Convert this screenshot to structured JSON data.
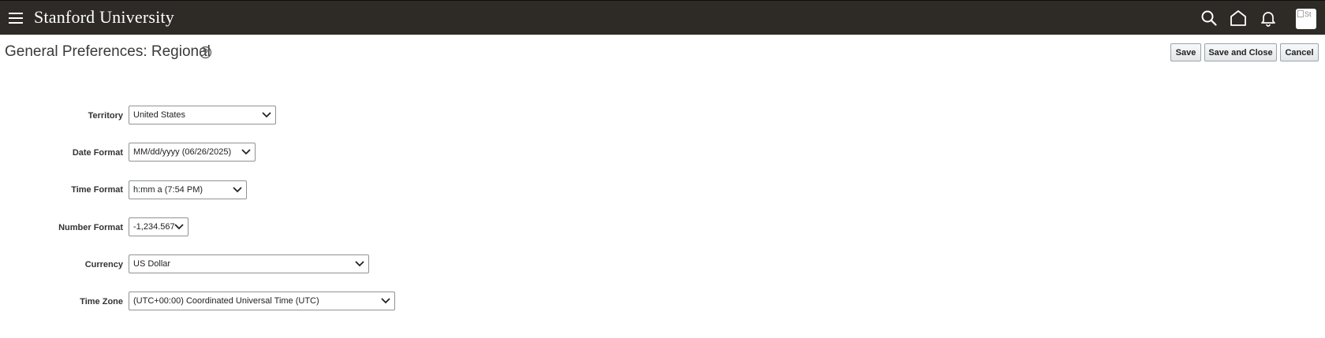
{
  "header": {
    "brand": "Stanford University",
    "avatar_alt": "St"
  },
  "page": {
    "title": "General Preferences: Regional"
  },
  "actions": {
    "save": "Save",
    "save_close": "Save and Close",
    "cancel": "Cancel"
  },
  "fields": {
    "territory": {
      "label": "Territory",
      "value": "United States"
    },
    "date_format": {
      "label": "Date Format",
      "value": "MM/dd/yyyy (06/26/2025)"
    },
    "time_format": {
      "label": "Time Format",
      "value": "h:mm a (7:54 PM)"
    },
    "number_format": {
      "label": "Number Format",
      "value": "-1,234.567"
    },
    "currency": {
      "label": "Currency",
      "value": "US Dollar"
    },
    "time_zone": {
      "label": "Time Zone",
      "value": "(UTC+00:00) Coordinated Universal Time (UTC)"
    }
  },
  "colors": {
    "header_bg": "#2e2b27",
    "header_fg": "#ffffff"
  },
  "icons": [
    "menu-icon",
    "search-icon",
    "home-icon",
    "bell-icon",
    "help-icon",
    "chevron-down-icon"
  ]
}
